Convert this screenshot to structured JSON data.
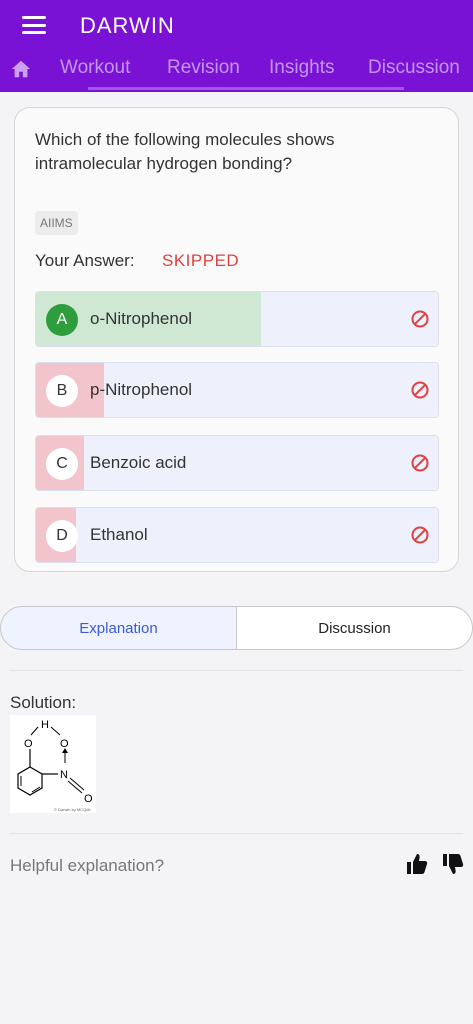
{
  "header": {
    "title": "DARWIN",
    "tabs": [
      "Workout",
      "Revision",
      "Insights",
      "Discussion"
    ]
  },
  "question": {
    "text": "Which of the following molecules shows intramolecular hydrogen bonding?",
    "tag": "AIIMS",
    "answer_label": "Your Answer:",
    "answer_value": "SKIPPED",
    "options": [
      {
        "letter": "A",
        "text": "o-Nitrophenol",
        "correct": true,
        "percent": 56
      },
      {
        "letter": "B",
        "text": "p-Nitrophenol",
        "correct": false,
        "percent": 17
      },
      {
        "letter": "C",
        "text": "Benzoic acid",
        "correct": false,
        "percent": 12
      },
      {
        "letter": "D",
        "text": "Ethanol",
        "correct": false,
        "percent": 10
      }
    ]
  },
  "tabs": {
    "explanation": "Explanation",
    "discussion": "Discussion"
  },
  "solution": {
    "label": "Solution:",
    "image_atoms": {
      "h": "H",
      "o1": "O",
      "o2": "O",
      "n": "N",
      "o3": "O"
    },
    "image_caption": "© Darwin by MCQdb"
  },
  "feedback": {
    "prompt": "Helpful explanation?"
  },
  "colors": {
    "brand": "#7a12d6",
    "correct": "#2e9d3c",
    "correct_fill": "#cfe8d4",
    "wrong_fill": "#f2c4cc",
    "skipped": "#e04040",
    "accent": "#3b5bd6"
  }
}
